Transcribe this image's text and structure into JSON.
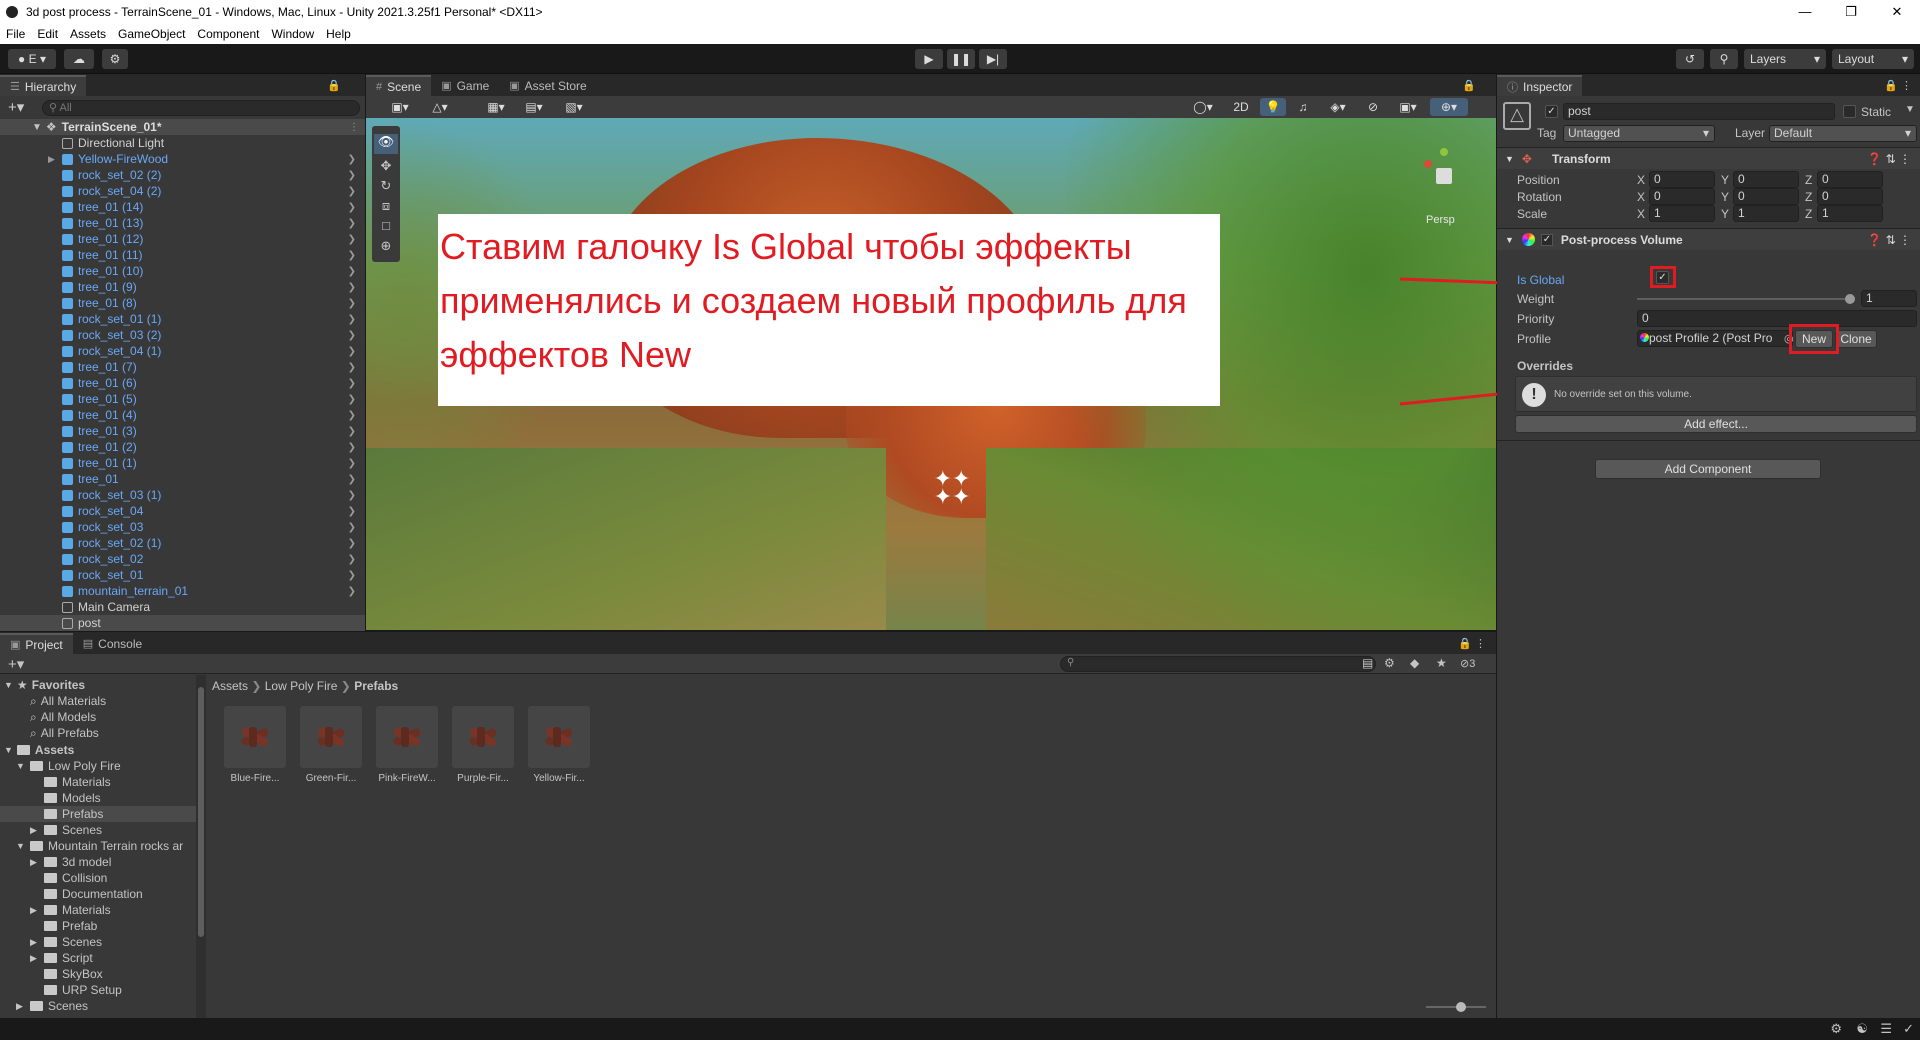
{
  "window": {
    "title": "3d post process - TerrainScene_01 - Windows, Mac, Linux - Unity 2021.3.25f1 Personal* <DX11>"
  },
  "menu": [
    "File",
    "Edit",
    "Assets",
    "GameObject",
    "Component",
    "Window",
    "Help"
  ],
  "toolbar": {
    "account_label": "E",
    "layers_label": "Layers",
    "layout_label": "Layout"
  },
  "hierarchy": {
    "tab": "Hierarchy",
    "search_placeholder": "All",
    "scene": "TerrainScene_01*",
    "items": [
      {
        "label": "Directional Light",
        "style": "plain",
        "icon": "gameobject-icon"
      },
      {
        "label": "Yellow-FireWood",
        "style": "blue",
        "icon": "prefab-icon"
      },
      {
        "label": "rock_set_02 (2)",
        "style": "blue",
        "icon": "prefab-icon"
      },
      {
        "label": "rock_set_04 (2)",
        "style": "blue",
        "icon": "prefab-icon"
      },
      {
        "label": "tree_01 (14)",
        "style": "blue",
        "icon": "prefab-icon"
      },
      {
        "label": "tree_01 (13)",
        "style": "blue",
        "icon": "prefab-icon"
      },
      {
        "label": "tree_01 (12)",
        "style": "blue",
        "icon": "prefab-icon"
      },
      {
        "label": "tree_01 (11)",
        "style": "blue",
        "icon": "prefab-icon"
      },
      {
        "label": "tree_01 (10)",
        "style": "blue",
        "icon": "prefab-icon"
      },
      {
        "label": "tree_01 (9)",
        "style": "blue",
        "icon": "prefab-icon"
      },
      {
        "label": "tree_01 (8)",
        "style": "blue",
        "icon": "prefab-icon"
      },
      {
        "label": "rock_set_01 (1)",
        "style": "blue",
        "icon": "prefab-icon"
      },
      {
        "label": "rock_set_03 (2)",
        "style": "blue",
        "icon": "prefab-icon"
      },
      {
        "label": "rock_set_04 (1)",
        "style": "blue",
        "icon": "prefab-icon"
      },
      {
        "label": "tree_01 (7)",
        "style": "blue",
        "icon": "prefab-icon"
      },
      {
        "label": "tree_01 (6)",
        "style": "blue",
        "icon": "prefab-icon"
      },
      {
        "label": "tree_01 (5)",
        "style": "blue",
        "icon": "prefab-icon"
      },
      {
        "label": "tree_01 (4)",
        "style": "blue",
        "icon": "prefab-icon"
      },
      {
        "label": "tree_01 (3)",
        "style": "blue",
        "icon": "prefab-icon"
      },
      {
        "label": "tree_01 (2)",
        "style": "blue",
        "icon": "prefab-icon"
      },
      {
        "label": "tree_01 (1)",
        "style": "blue",
        "icon": "prefab-icon"
      },
      {
        "label": "tree_01",
        "style": "blue",
        "icon": "prefab-icon"
      },
      {
        "label": "rock_set_03 (1)",
        "style": "blue",
        "icon": "prefab-icon"
      },
      {
        "label": "rock_set_04",
        "style": "blue",
        "icon": "prefab-icon"
      },
      {
        "label": "rock_set_03",
        "style": "blue",
        "icon": "prefab-icon"
      },
      {
        "label": "rock_set_02 (1)",
        "style": "blue",
        "icon": "prefab-icon"
      },
      {
        "label": "rock_set_02",
        "style": "blue",
        "icon": "prefab-icon"
      },
      {
        "label": "rock_set_01",
        "style": "blue",
        "icon": "prefab-icon"
      },
      {
        "label": "mountain_terrain_01",
        "style": "blue",
        "icon": "prefab-icon"
      },
      {
        "label": "Main Camera",
        "style": "plain",
        "icon": "gameobject-icon"
      },
      {
        "label": "post",
        "style": "plain",
        "icon": "gameobject-icon"
      }
    ]
  },
  "scene_view": {
    "tabs": [
      "Scene",
      "Game",
      "Asset Store"
    ],
    "mode_2d": "2D",
    "persp_label": "Persp",
    "annotation": "Ставим галочку Is Global чтобы эффекты применялись и создаем новый профиль для эффектов New"
  },
  "project": {
    "tabs": [
      "Project",
      "Console"
    ],
    "breadcrumb": [
      "Assets",
      "Low Poly Fire",
      "Prefabs"
    ],
    "hidden_count": "3",
    "favorites_label": "Favorites",
    "favorites": [
      "All Materials",
      "All Models",
      "All Prefabs"
    ],
    "assets_label": "Assets",
    "tree": [
      {
        "label": "Low Poly Fire",
        "depth": 1
      },
      {
        "label": "Materials",
        "depth": 2
      },
      {
        "label": "Models",
        "depth": 2
      },
      {
        "label": "Prefabs",
        "depth": 2
      },
      {
        "label": "Scenes",
        "depth": 2
      },
      {
        "label": "Mountain Terrain rocks ar",
        "depth": 1
      },
      {
        "label": "3d model",
        "depth": 2
      },
      {
        "label": "Collision",
        "depth": 2
      },
      {
        "label": "Documentation",
        "depth": 2
      },
      {
        "label": "Materials",
        "depth": 2
      },
      {
        "label": "Prefab",
        "depth": 2
      },
      {
        "label": "Scenes",
        "depth": 2
      },
      {
        "label": "Script",
        "depth": 2
      },
      {
        "label": "SkyBox",
        "depth": 2
      },
      {
        "label": "URP Setup",
        "depth": 2
      },
      {
        "label": "Scenes",
        "depth": 1
      }
    ],
    "prefabs": [
      "Blue-Fire...",
      "Green-Fir...",
      "Pink-FireW...",
      "Purple-Fir...",
      "Yellow-Fir..."
    ]
  },
  "inspector": {
    "tab": "Inspector",
    "object_name": "post",
    "static_label": "Static",
    "tag_label": "Tag",
    "tag_value": "Untagged",
    "layer_label": "Layer",
    "layer_value": "Default",
    "transform": {
      "title": "Transform",
      "position_label": "Position",
      "rotation_label": "Rotation",
      "scale_label": "Scale",
      "axis_x": "X",
      "axis_y": "Y",
      "axis_z": "Z",
      "position": [
        "0",
        "0",
        "0"
      ],
      "rotation": [
        "0",
        "0",
        "0"
      ],
      "scale": [
        "1",
        "1",
        "1"
      ]
    },
    "volume": {
      "title": "Post-process Volume",
      "is_global_label": "Is Global",
      "is_global": true,
      "weight_label": "Weight",
      "weight": "1",
      "weight_fraction": 1.0,
      "priority_label": "Priority",
      "priority": "0",
      "profile_label": "Profile",
      "profile_value": "post Profile 2 (Post Pro",
      "new_label": "New",
      "clone_label": "Clone",
      "overrides_label": "Overrides",
      "no_override": "No override set on this volume.",
      "add_effect": "Add effect..."
    },
    "add_component": "Add Component"
  },
  "colors": {
    "highlight": "#e11b22",
    "accent_blue": "#6aa8f5"
  }
}
